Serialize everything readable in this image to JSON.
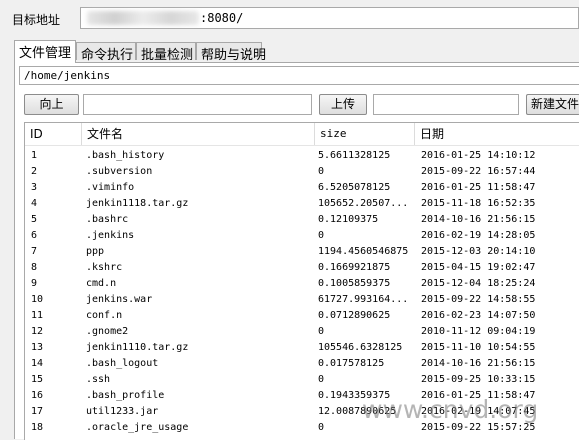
{
  "address": {
    "label": "目标地址",
    "value_visible": ":8080/"
  },
  "tabs": [
    {
      "label": "文件管理",
      "active": true
    },
    {
      "label": "命令执行",
      "active": false
    },
    {
      "label": "批量检测",
      "active": false
    },
    {
      "label": "帮助与说明",
      "active": false
    }
  ],
  "file_manager": {
    "path": "/home/jenkins",
    "up_label": "向上",
    "upload_label": "上传",
    "new_file_label": "新建文件",
    "columns": {
      "id": "ID",
      "name": "文件名",
      "size": "size",
      "date": "日期"
    },
    "rows": [
      {
        "id": "1",
        "name": ".bash_history",
        "size": "5.6611328125",
        "date": "2016-01-25 14:10:12"
      },
      {
        "id": "2",
        "name": ".subversion",
        "size": "0",
        "date": "2015-09-22 16:57:44"
      },
      {
        "id": "3",
        "name": ".viminfo",
        "size": "6.5205078125",
        "date": "2016-01-25 11:58:47"
      },
      {
        "id": "4",
        "name": "jenkin1118.tar.gz",
        "size": "105652.20507...",
        "date": "2015-11-18 16:52:35"
      },
      {
        "id": "5",
        "name": ".bashrc",
        "size": "0.12109375",
        "date": "2014-10-16 21:56:15"
      },
      {
        "id": "6",
        "name": ".jenkins",
        "size": "0",
        "date": "2016-02-19 14:28:05"
      },
      {
        "id": "7",
        "name": "ppp",
        "size": "1194.4560546875",
        "date": "2015-12-03 20:14:10"
      },
      {
        "id": "8",
        "name": ".kshrc",
        "size": "0.1669921875",
        "date": "2015-04-15 19:02:47"
      },
      {
        "id": "9",
        "name": "cmd.n",
        "size": "0.1005859375",
        "date": "2015-12-04 18:25:24"
      },
      {
        "id": "10",
        "name": "jenkins.war",
        "size": "61727.993164...",
        "date": "2015-09-22 14:58:55"
      },
      {
        "id": "11",
        "name": "conf.n",
        "size": "0.0712890625",
        "date": "2016-02-23 14:07:50"
      },
      {
        "id": "12",
        "name": ".gnome2",
        "size": "0",
        "date": "2010-11-12 09:04:19"
      },
      {
        "id": "13",
        "name": "jenkin1110.tar.gz",
        "size": "105546.6328125",
        "date": "2015-11-10 10:54:55"
      },
      {
        "id": "14",
        "name": ".bash_logout",
        "size": "0.017578125",
        "date": "2014-10-16 21:56:15"
      },
      {
        "id": "15",
        "name": ".ssh",
        "size": "0",
        "date": "2015-09-25 10:33:15"
      },
      {
        "id": "16",
        "name": ".bash_profile",
        "size": "0.1943359375",
        "date": "2016-01-25 11:58:47"
      },
      {
        "id": "17",
        "name": "util1233.jar",
        "size": "12.0087890625",
        "date": "2016-02-19 14:07:45"
      },
      {
        "id": "18",
        "name": ".oracle_jre_usage",
        "size": "0",
        "date": "2015-09-22 15:57:25"
      }
    ]
  },
  "watermark": "www.cnvd.org"
}
